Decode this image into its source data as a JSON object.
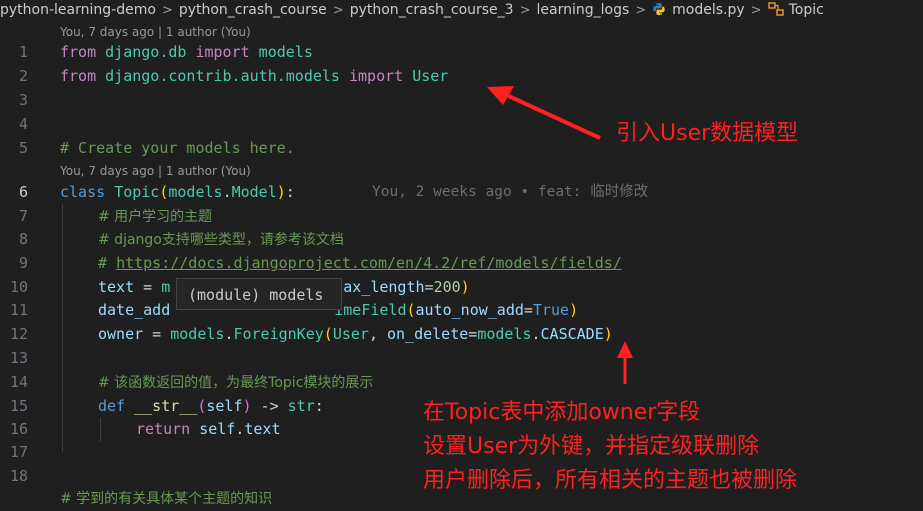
{
  "breadcrumb": {
    "items": [
      "python-learning-demo",
      "python_crash_course",
      "python_crash_course_3",
      "learning_logs",
      "models.py",
      "Topic"
    ],
    "separator": ">"
  },
  "codelens": {
    "top": "You, 7 days ago | 1 author (You)",
    "class": "You, 7 days ago | 1 author (You)"
  },
  "line_numbers": [
    "1",
    "2",
    "3",
    "4",
    "5",
    "6",
    "7",
    "8",
    "9",
    "10",
    "11",
    "12",
    "13",
    "14",
    "15",
    "16",
    "17",
    "18"
  ],
  "code": {
    "l1": {
      "kw": "from",
      "mod": " django.db ",
      "kw2": "import",
      "name": " models"
    },
    "l2": {
      "kw": "from",
      "mod": " django.contrib.auth.models ",
      "kw2": "import",
      "name": " User"
    },
    "l5": "# Create your models here.",
    "l6": {
      "kw": "class",
      "cls": "Topic",
      "open": "(",
      "base_mod": "models",
      "dot": ".",
      "base": "Model",
      "close": ")",
      "colon": ":"
    },
    "l7": "# 用户学习的主题",
    "l8": "# django支持哪些类型，请参考该文档",
    "l9_prefix": "# ",
    "l9_link": "https://docs.djangoproject.com/en/4.2/ref/models/fields/",
    "l10": {
      "a": "text",
      "b": " = ",
      "c": "m",
      "d": "ax_length",
      "e": "=",
      "f": "200",
      "g": ")"
    },
    "l11": {
      "a": "date_add",
      "b": "imeField",
      "c": "(",
      "d": "auto_now_add",
      "e": "=",
      "f": "True",
      "g": ")"
    },
    "l12": {
      "a": "owner",
      "b": " = ",
      "c": "models",
      "d": ".",
      "e": "ForeignKey",
      "f": "(",
      "g": "User",
      "h": ", ",
      "i": "on_delete",
      "j": "=",
      "k": "models",
      "l": ".",
      "m": "CASCADE",
      "n": ")"
    },
    "l14": "# 该函数返回的值，为最终Topic模块的展示",
    "l15": {
      "kw": "def",
      "fn": " __str__",
      "open": "(",
      "self": "self",
      "close": ")",
      "arrow": " -> ",
      "type": "str",
      "colon": ":"
    },
    "l16": {
      "kw": "return",
      "self": " self",
      "dot": ".",
      "attr": "text"
    },
    "l19": "# 学到的有关具体某个主题的知识"
  },
  "blame": "You, 2 weeks ago • feat: 临时修改",
  "hover": "(module) models",
  "annotations": {
    "a1": "引入User数据模型",
    "a2_line1": "在Topic表中添加owner字段",
    "a2_line2": "设置User为外键，并指定级联删除",
    "a2_line3": "用户删除后，所有相关的主题也被删除"
  },
  "colors": {
    "annotation": "#ff2020",
    "editor_bg": "#1f1f1f"
  }
}
